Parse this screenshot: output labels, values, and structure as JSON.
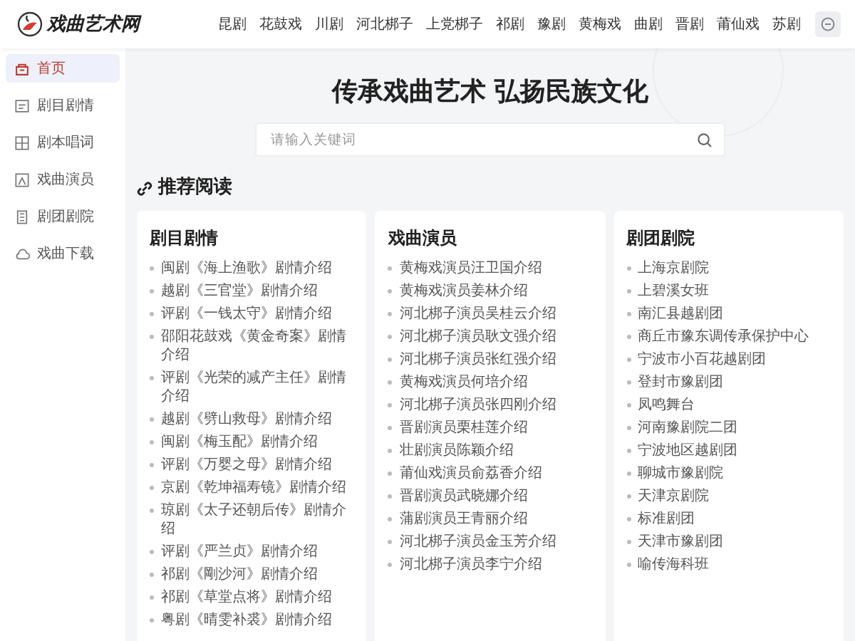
{
  "header": {
    "logo": "戏曲艺术网",
    "nav": [
      "昆剧",
      "花鼓戏",
      "川剧",
      "河北梆子",
      "上党梆子",
      "祁剧",
      "豫剧",
      "黄梅戏",
      "曲剧",
      "晋剧",
      "莆仙戏",
      "苏剧"
    ]
  },
  "sidebar": {
    "items": [
      {
        "label": "首页",
        "selected": true
      },
      {
        "label": "剧目剧情",
        "selected": false
      },
      {
        "label": "剧本唱词",
        "selected": false
      },
      {
        "label": "戏曲演员",
        "selected": false
      },
      {
        "label": "剧团剧院",
        "selected": false
      },
      {
        "label": "戏曲下载",
        "selected": false
      }
    ]
  },
  "hero": {
    "title": "传承戏曲艺术 弘扬民族文化",
    "search": {
      "placeholder": "请输入关键词"
    }
  },
  "section": {
    "title": "推荐阅读",
    "cards": [
      {
        "title": "剧目剧情",
        "items": [
          "闽剧《海上渔歌》剧情介绍",
          "越剧《三官堂》剧情介绍",
          "评剧《一钱太守》剧情介绍",
          "邵阳花鼓戏《黄金奇案》剧情介绍",
          "评剧《光荣的减产主任》剧情介绍",
          "越剧《劈山救母》剧情介绍",
          "闽剧《梅玉配》剧情介绍",
          "评剧《万婴之母》剧情介绍",
          "京剧《乾坤福寿镜》剧情介绍",
          "琼剧《太子还朝后传》剧情介绍",
          "评剧《严兰贞》剧情介绍",
          "祁剧《剛沙河》剧情介绍",
          "祁剧《草堂点将》剧情介绍",
          "粤剧《晴雯补裘》剧情介绍"
        ]
      },
      {
        "title": "戏曲演员",
        "items": [
          "黄梅戏演员汪卫国介绍",
          "黄梅戏演员姜林介绍",
          "河北梆子演员吴桂云介绍",
          "河北梆子演员耿文强介绍",
          "河北梆子演员张红强介绍",
          "黄梅戏演员何培介绍",
          "河北梆子演员张四刚介绍",
          "晋剧演员栗桂莲介绍",
          "壮剧演员陈颖介绍",
          "莆仙戏演员俞荔香介绍",
          "晋剧演员武晓娜介绍",
          "蒲剧演员王青丽介绍",
          "河北梆子演员金玉芳介绍",
          "河北梆子演员李宁介绍"
        ]
      },
      {
        "title": "剧团剧院",
        "items": [
          "上海京剧院",
          "上碧溪女班",
          "南汇县越剧团",
          "商丘市豫东调传承保护中心",
          "宁波市小百花越剧团",
          "登封市豫剧团",
          "凤鸣舞台",
          "河南豫剧院二团",
          "宁波地区越剧团",
          "聊城市豫剧院",
          "天津京剧院",
          "标准剧团",
          "天津市豫剧团",
          "喻传海科班"
        ]
      }
    ]
  }
}
